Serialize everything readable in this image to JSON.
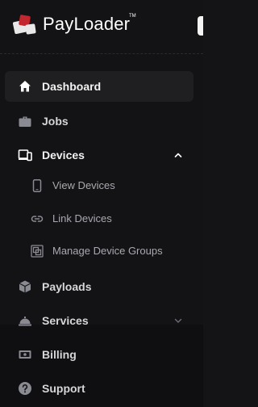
{
  "brand": {
    "name": "PayLoader",
    "trademark": "TM",
    "logo_colors": [
      "#e8e8e8",
      "#c4262e"
    ]
  },
  "nav": {
    "dashboard": {
      "label": "Dashboard",
      "icon": "home-icon",
      "active": true
    },
    "jobs": {
      "label": "Jobs",
      "icon": "briefcase-icon"
    },
    "devices": {
      "label": "Devices",
      "icon": "devices-icon",
      "expanded": true,
      "children": [
        {
          "label": "View Devices",
          "icon": "smartphone-icon"
        },
        {
          "label": "Link Devices",
          "icon": "link-icon"
        },
        {
          "label": "Manage Device Groups",
          "icon": "device-groups-icon"
        }
      ]
    },
    "payloads": {
      "label": "Payloads",
      "icon": "package-icon"
    },
    "services": {
      "label": "Services",
      "icon": "services-icon",
      "expanded": false
    },
    "billing": {
      "label": "Billing",
      "icon": "billing-icon"
    },
    "support": {
      "label": "Support",
      "icon": "help-icon"
    }
  },
  "colors": {
    "background": "#131315",
    "active_background": "#1f1f22",
    "text": "#f2f2f2",
    "subtext": "#a9aab0",
    "icon": "#8a8b92"
  }
}
